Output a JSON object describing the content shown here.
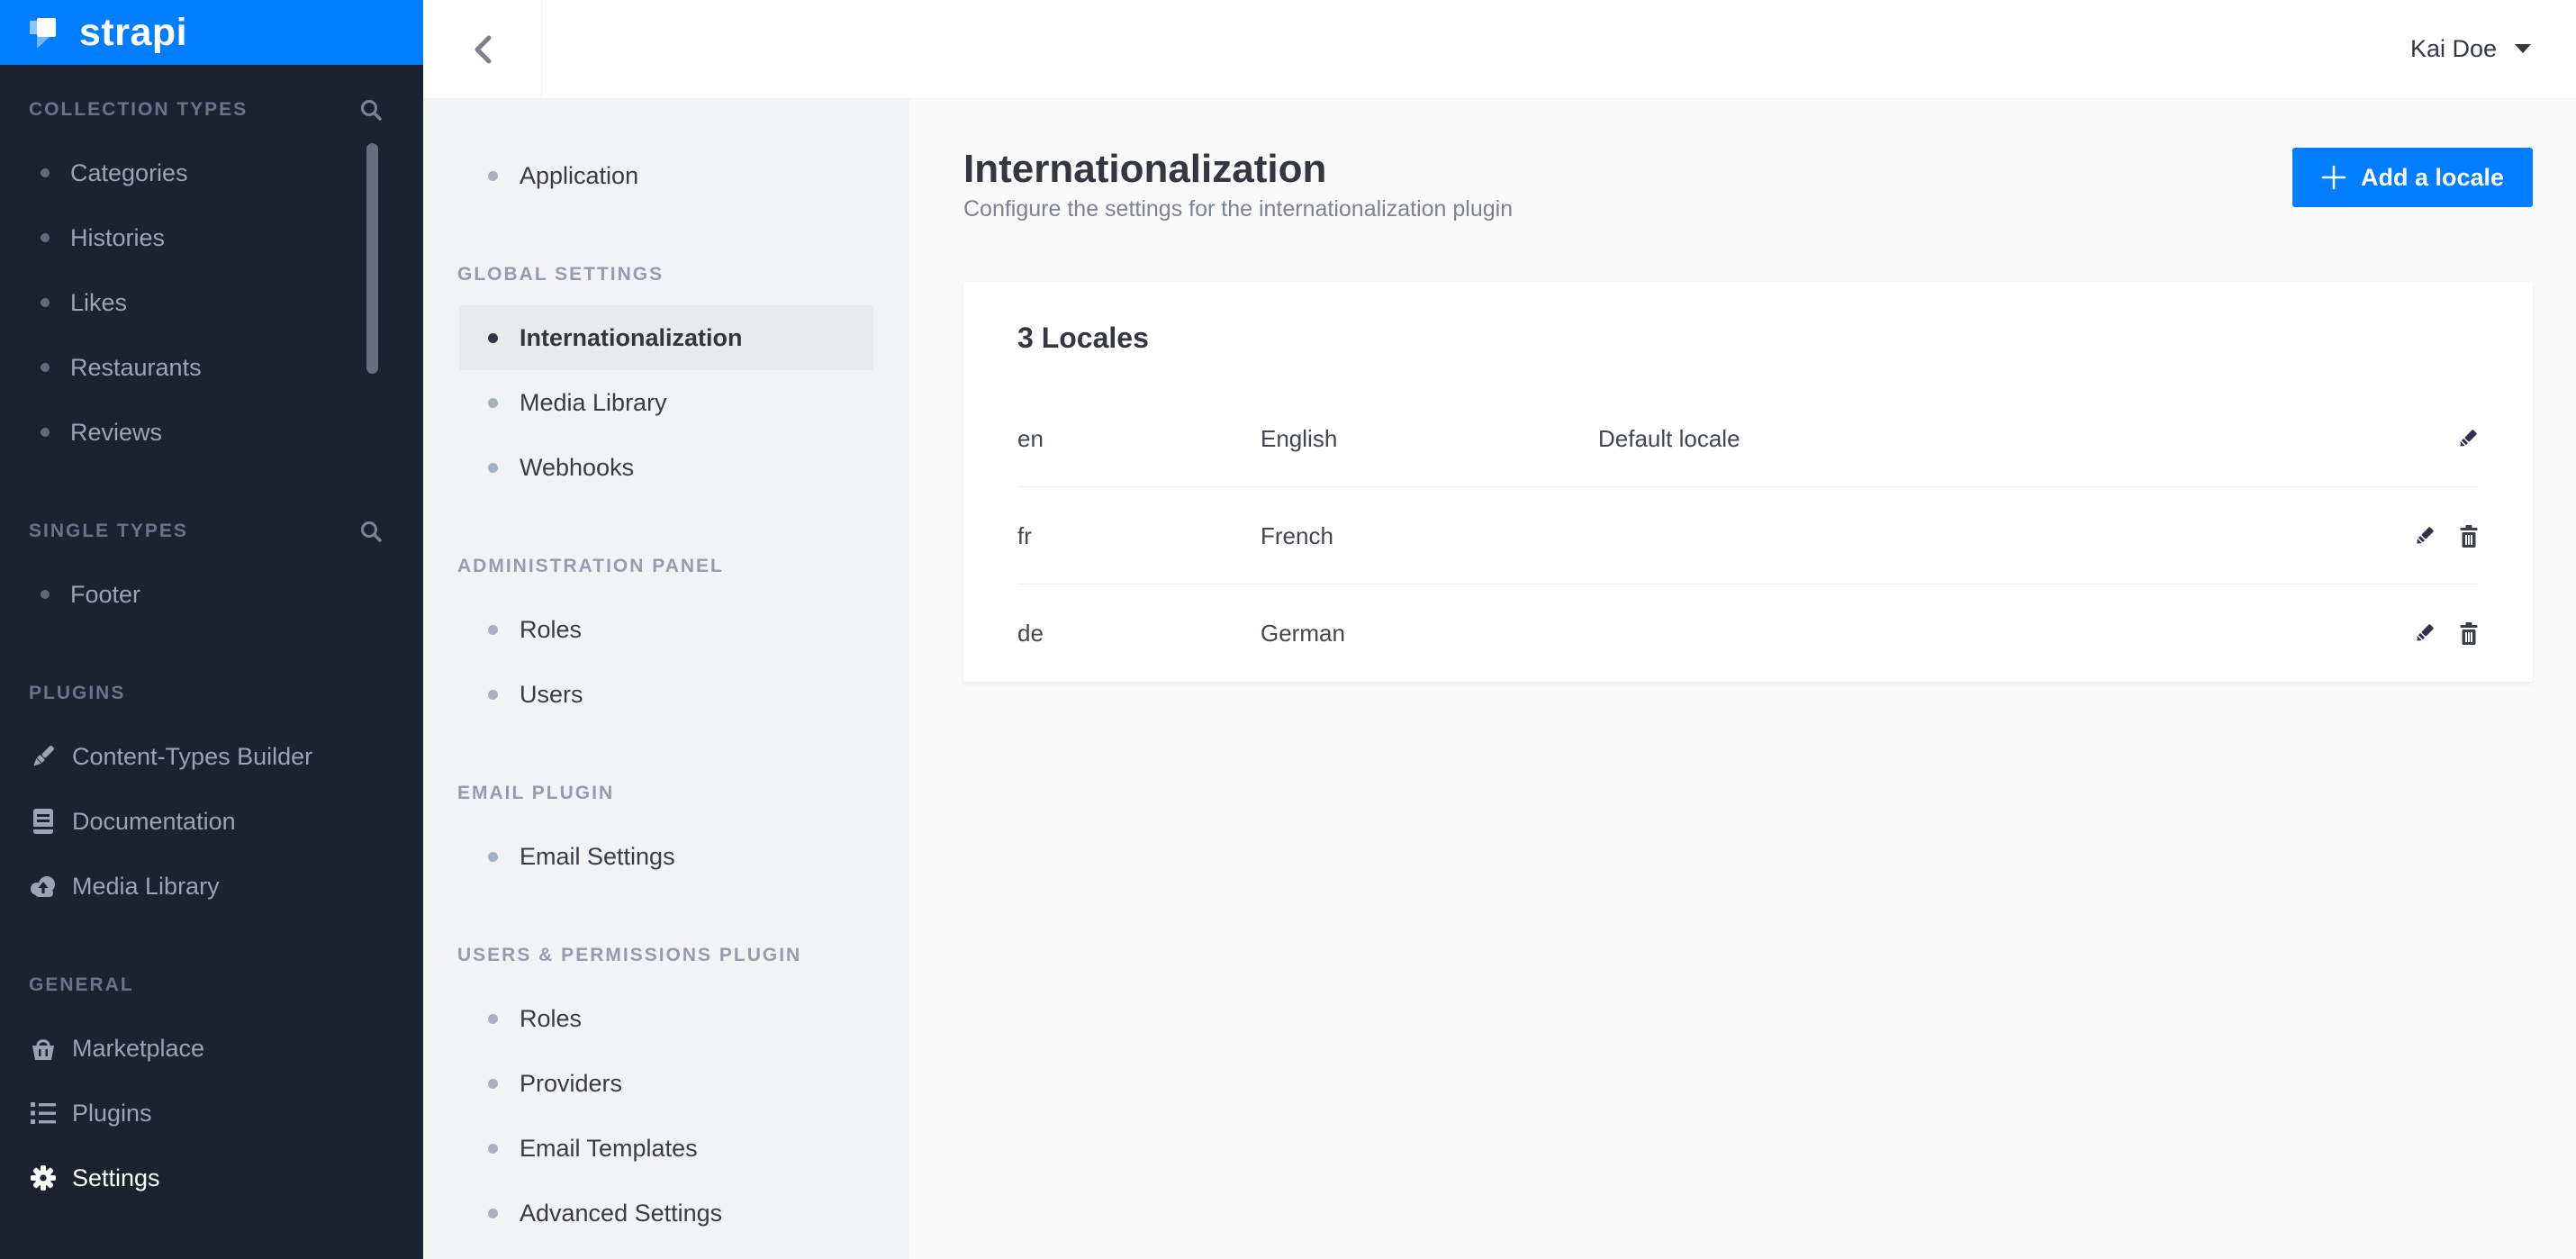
{
  "brand": {
    "logo_text": "strapi",
    "accent_color": "#007eff"
  },
  "topbar": {
    "user_name": "Kai Doe"
  },
  "nav": {
    "collection_types": {
      "header": "COLLECTION TYPES",
      "search_icon": "search-icon",
      "items": [
        "Categories",
        "Histories",
        "Likes",
        "Restaurants",
        "Reviews"
      ]
    },
    "single_types": {
      "header": "SINGLE TYPES",
      "search_icon": "search-icon",
      "items": [
        "Footer"
      ]
    },
    "plugins": {
      "header": "PLUGINS",
      "items": [
        {
          "label": "Content-Types Builder",
          "icon": "paintbrush-icon"
        },
        {
          "label": "Documentation",
          "icon": "book-icon"
        },
        {
          "label": "Media Library",
          "icon": "cloud-upload-icon"
        }
      ]
    },
    "general": {
      "header": "GENERAL",
      "items": [
        {
          "label": "Marketplace",
          "icon": "basket-icon"
        },
        {
          "label": "Plugins",
          "icon": "list-icon"
        },
        {
          "label": "Settings",
          "icon": "gear-icon",
          "active": true
        }
      ]
    }
  },
  "settings_nav": {
    "top_items": [
      "Application"
    ],
    "sections": [
      {
        "header": "GLOBAL SETTINGS",
        "items": [
          "Internationalization",
          "Media Library",
          "Webhooks"
        ],
        "active_item": "Internationalization"
      },
      {
        "header": "ADMINISTRATION PANEL",
        "items": [
          "Roles",
          "Users"
        ]
      },
      {
        "header": "EMAIL PLUGIN",
        "items": [
          "Email Settings"
        ]
      },
      {
        "header": "USERS & PERMISSIONS PLUGIN",
        "items": [
          "Roles",
          "Providers",
          "Email Templates",
          "Advanced Settings"
        ]
      }
    ]
  },
  "page": {
    "title": "Internationalization",
    "subtitle": "Configure the settings for the internationalization plugin",
    "add_button_label": "Add a locale"
  },
  "locales": {
    "card_title": "3 Locales",
    "rows": [
      {
        "code": "en",
        "name": "English",
        "note": "Default locale",
        "actions": [
          "edit"
        ]
      },
      {
        "code": "fr",
        "name": "French",
        "note": "",
        "actions": [
          "edit",
          "delete"
        ]
      },
      {
        "code": "de",
        "name": "German",
        "note": "",
        "actions": [
          "edit",
          "delete"
        ]
      }
    ]
  },
  "colors": {
    "accent": "#007eff",
    "dark_sidebar": "#1b2330",
    "content_bg": "#fafafb",
    "settings_sidebar_bg": "#f2f3f4"
  }
}
